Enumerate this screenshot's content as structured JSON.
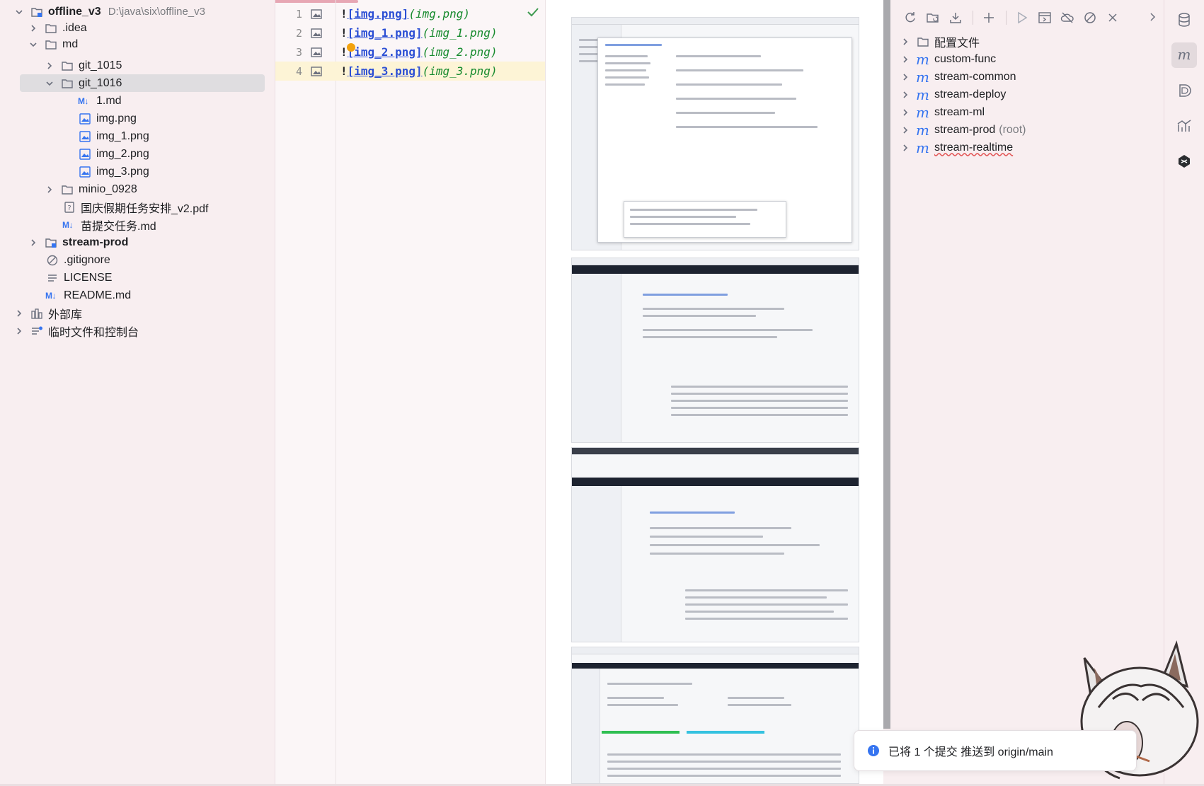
{
  "project_tree": {
    "items": [
      {
        "label": "offline_v3",
        "path": "D:\\java\\six\\offline_v3"
      },
      {
        "label": ".idea"
      },
      {
        "label": "md"
      },
      {
        "label": "git_1015"
      },
      {
        "label": "git_1016"
      },
      {
        "label": "1.md",
        "badge": "M↓"
      },
      {
        "label": "img.png"
      },
      {
        "label": "img_1.png"
      },
      {
        "label": "img_2.png"
      },
      {
        "label": "img_3.png"
      },
      {
        "label": "minio_0928"
      },
      {
        "label": "国庆假期任务安排_v2.pdf"
      },
      {
        "label": "苗提交任务.md",
        "badge": "M↓"
      },
      {
        "label": "stream-prod"
      },
      {
        "label": ".gitignore"
      },
      {
        "label": "LICENSE"
      },
      {
        "label": "README.md",
        "badge": "M↓"
      },
      {
        "label": "外部库"
      },
      {
        "label": "临时文件和控制台"
      }
    ]
  },
  "editor": {
    "lines": [
      {
        "num": "1",
        "bang": "!",
        "link": "[img.png]",
        "url": "(img.png)"
      },
      {
        "num": "2",
        "bang": "!",
        "link": "[img_1.png]",
        "url": "(img_1.png)"
      },
      {
        "num": "3",
        "bang": "!",
        "link": "[img_2.png]",
        "url": "(img_2.png)"
      },
      {
        "num": "4",
        "bang": "!",
        "link": "[img_3.png]",
        "url": "(img_3.png)"
      }
    ],
    "current_line": 4
  },
  "maven": {
    "toolbar_icons": [
      "reload-icon",
      "open-folder-icon",
      "download-icon",
      "add-icon",
      "run-icon",
      "execute-goal-icon",
      "offline-icon",
      "skip-tests-icon",
      "collapse-all-icon"
    ],
    "items": [
      {
        "label": "配置文件",
        "type": "folder"
      },
      {
        "label": "custom-func",
        "type": "module"
      },
      {
        "label": "stream-common",
        "type": "module"
      },
      {
        "label": "stream-deploy",
        "type": "module"
      },
      {
        "label": "stream-ml",
        "type": "module"
      },
      {
        "label": "stream-prod",
        "suffix": "(root)",
        "type": "module"
      },
      {
        "label": "stream-realtime",
        "type": "module"
      }
    ]
  },
  "tool_strip": {
    "icons": [
      "database-icon",
      "maven-icon",
      "copilot-icon",
      "chart-icon",
      "ai-assistant-icon"
    ],
    "maven_badge": "m"
  },
  "notification": {
    "text": "已将 1 个提交 推送到 origin/main"
  },
  "colors": {
    "background": "#f8eef0",
    "accent": "#3574f0",
    "link": "#2c4fd4",
    "url": "#168a2d"
  }
}
